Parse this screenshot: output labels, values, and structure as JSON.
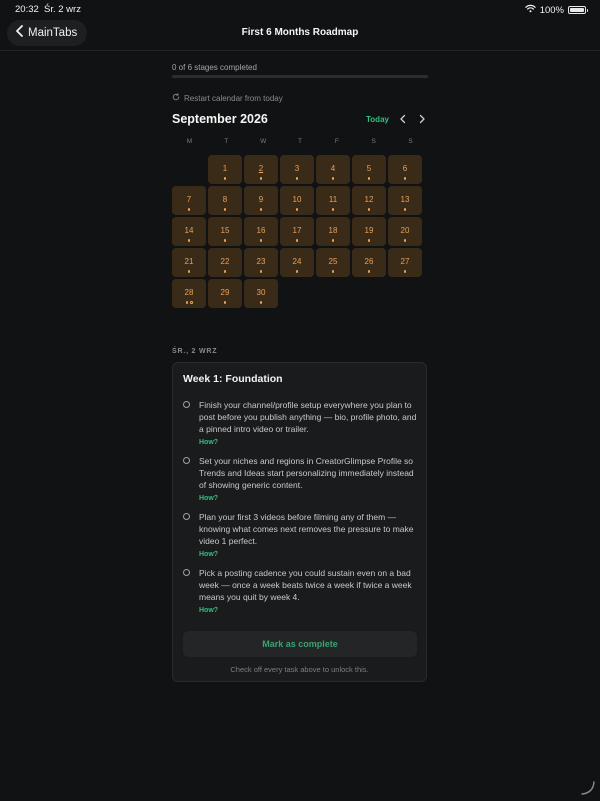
{
  "status_bar": {
    "time": "20:32",
    "date": "Śr. 2 wrz",
    "battery": "100%",
    "battery_level": 1.0
  },
  "nav": {
    "back_label": "MainTabs",
    "title": "First 6 Months Roadmap"
  },
  "progress": {
    "text": "0 of 6 stages completed",
    "fraction": 0
  },
  "restart_label": "Restart calendar from today",
  "calendar": {
    "month_title": "September 2026",
    "today_label": "Today",
    "weekdays": [
      "M",
      "T",
      "W",
      "T",
      "F",
      "S",
      "S"
    ],
    "leading_blanks": 1,
    "today_day": 2,
    "days": [
      {
        "d": "1",
        "dots": 1
      },
      {
        "d": "2",
        "dots": 1
      },
      {
        "d": "3",
        "dots": 1
      },
      {
        "d": "4",
        "dots": 1
      },
      {
        "d": "5",
        "dots": 1
      },
      {
        "d": "6",
        "dots": 1
      },
      {
        "d": "7",
        "dots": 1
      },
      {
        "d": "8",
        "dots": 1
      },
      {
        "d": "9",
        "dots": 1
      },
      {
        "d": "10",
        "dots": 1
      },
      {
        "d": "11",
        "dots": 1
      },
      {
        "d": "12",
        "dots": 1
      },
      {
        "d": "13",
        "dots": 1
      },
      {
        "d": "14",
        "dots": 1
      },
      {
        "d": "15",
        "dots": 1
      },
      {
        "d": "16",
        "dots": 1
      },
      {
        "d": "17",
        "dots": 1
      },
      {
        "d": "18",
        "dots": 1
      },
      {
        "d": "19",
        "dots": 1
      },
      {
        "d": "20",
        "dots": 1
      },
      {
        "d": "21",
        "dots": 1
      },
      {
        "d": "22",
        "dots": 1
      },
      {
        "d": "23",
        "dots": 1
      },
      {
        "d": "24",
        "dots": 1
      },
      {
        "d": "25",
        "dots": 1
      },
      {
        "d": "26",
        "dots": 1
      },
      {
        "d": "27",
        "dots": 1
      },
      {
        "d": "28",
        "dots": 2
      },
      {
        "d": "29",
        "dots": 1
      },
      {
        "d": "30",
        "dots": 1
      }
    ]
  },
  "selected_date_label": "ŚR., 2 WRZ",
  "week_card": {
    "title": "Week 1: Foundation",
    "tasks": [
      {
        "text": "Finish your channel/profile setup everywhere you plan to post before you publish anything — bio, profile photo, and a pinned intro video or trailer.",
        "how": "How?"
      },
      {
        "text": "Set your niches and regions in CreatorGlimpse Profile so Trends and Ideas start personalizing immediately instead of showing generic content.",
        "how": "How?"
      },
      {
        "text": "Plan your first 3 videos before filming any of them — knowing what comes next removes the pressure to make video 1 perfect.",
        "how": "How?"
      },
      {
        "text": "Pick a posting cadence you could sustain even on a bad week — once a week beats twice a week if twice a week means you quit by week 4.",
        "how": "How?"
      }
    ],
    "complete_label": "Mark as complete",
    "unlock_note": "Check off every task above to unlock this."
  },
  "colors": {
    "accent_green": "#2ec27e",
    "day_cell_bg": "#3a2b18",
    "day_text": "#e8a05a"
  },
  "icons": {
    "back": "chevron-left-icon",
    "restart": "refresh-icon",
    "prev": "chevron-left-icon",
    "next": "chevron-right-icon",
    "wifi": "wifi-icon",
    "battery": "battery-icon"
  }
}
